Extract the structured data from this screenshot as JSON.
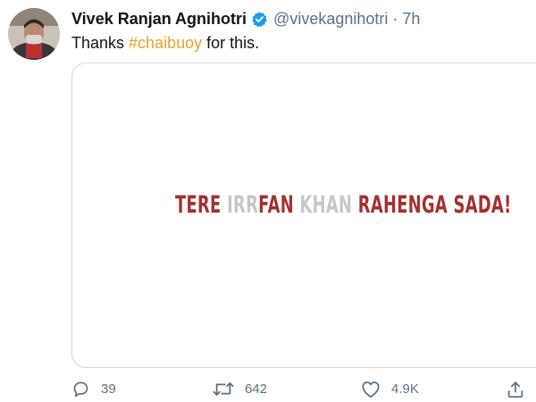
{
  "tweet": {
    "author_name": "Vivek Ranjan Agnihotri",
    "handle": "@vivekagnihotri",
    "separator": "·",
    "time": "7h",
    "text_before": "Thanks ",
    "hashtag": "#chaibuoy",
    "text_after": " for this."
  },
  "media": {
    "parts": [
      {
        "text": "TERE ",
        "color": "#a5302f"
      },
      {
        "text": "IRR",
        "color": "#c6c6c6"
      },
      {
        "text": "FAN ",
        "color": "#a5302f"
      },
      {
        "text": "KHAN ",
        "color": "#c6c6c6"
      },
      {
        "text": "RAHENGA SADA!",
        "color": "#a5302f"
      }
    ]
  },
  "actions": {
    "reply_count": "39",
    "retweet_count": "642",
    "like_count": "4.9K"
  },
  "colors": {
    "verified_badge": "#1d9bf0",
    "hashtag": "#e8a22b",
    "secondary_text": "#5b7083"
  },
  "icons": {
    "reply": "reply-icon",
    "retweet": "retweet-icon",
    "like": "heart-icon",
    "share": "share-icon",
    "verified": "verified-badge-icon"
  }
}
